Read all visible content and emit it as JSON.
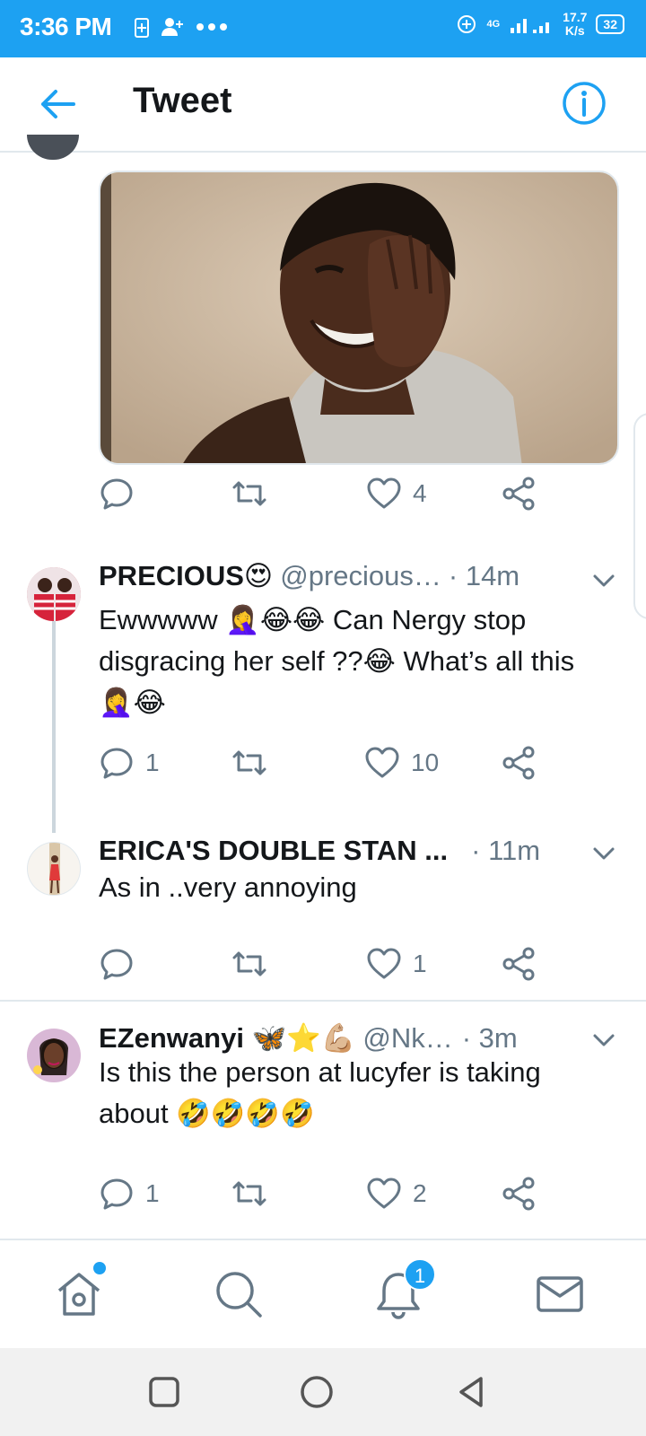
{
  "status_bar": {
    "time": "3:36 PM",
    "network": "4G",
    "speed_value": "17.7",
    "speed_unit": "K/s",
    "battery": "32"
  },
  "header": {
    "title": "Tweet"
  },
  "parent_tweet_actions": {
    "reply_count": "",
    "retweet_count": "",
    "like_count": "4"
  },
  "replies": [
    {
      "name": "PRECIOUS😍",
      "handle": "@precious…",
      "time": "· 14m",
      "text": "Ewwwww 🤦‍♀️😂😂 Can Nergy stop disgracing her self ??😂 What’s all this 🤦‍♀️😂",
      "reply_count": "1",
      "retweet_count": "",
      "like_count": "10"
    },
    {
      "name": "ERICA'S DOUBLE STAN ...",
      "handle": "",
      "time": "· 11m",
      "text": "As in ..very annoying",
      "reply_count": "",
      "retweet_count": "",
      "like_count": "1"
    },
    {
      "name": "EZenwanyi 🦋⭐💪🏼",
      "handle": "@Nk…",
      "time": "· 3m",
      "text": "Is this the person at lucyfer is taking about 🤣🤣🤣🤣",
      "reply_count": "1",
      "retweet_count": "",
      "like_count": "2"
    }
  ],
  "bottom_nav": {
    "notifications_badge": "1"
  },
  "colors": {
    "brand": "#1da1f2",
    "secondary_text": "#657786",
    "divider": "#e1e8ed"
  },
  "icons": [
    "back-arrow-icon",
    "info-icon",
    "reply-icon",
    "retweet-icon",
    "like-icon",
    "share-icon",
    "chevron-down-icon",
    "home-icon",
    "search-icon",
    "notifications-icon",
    "messages-icon"
  ]
}
